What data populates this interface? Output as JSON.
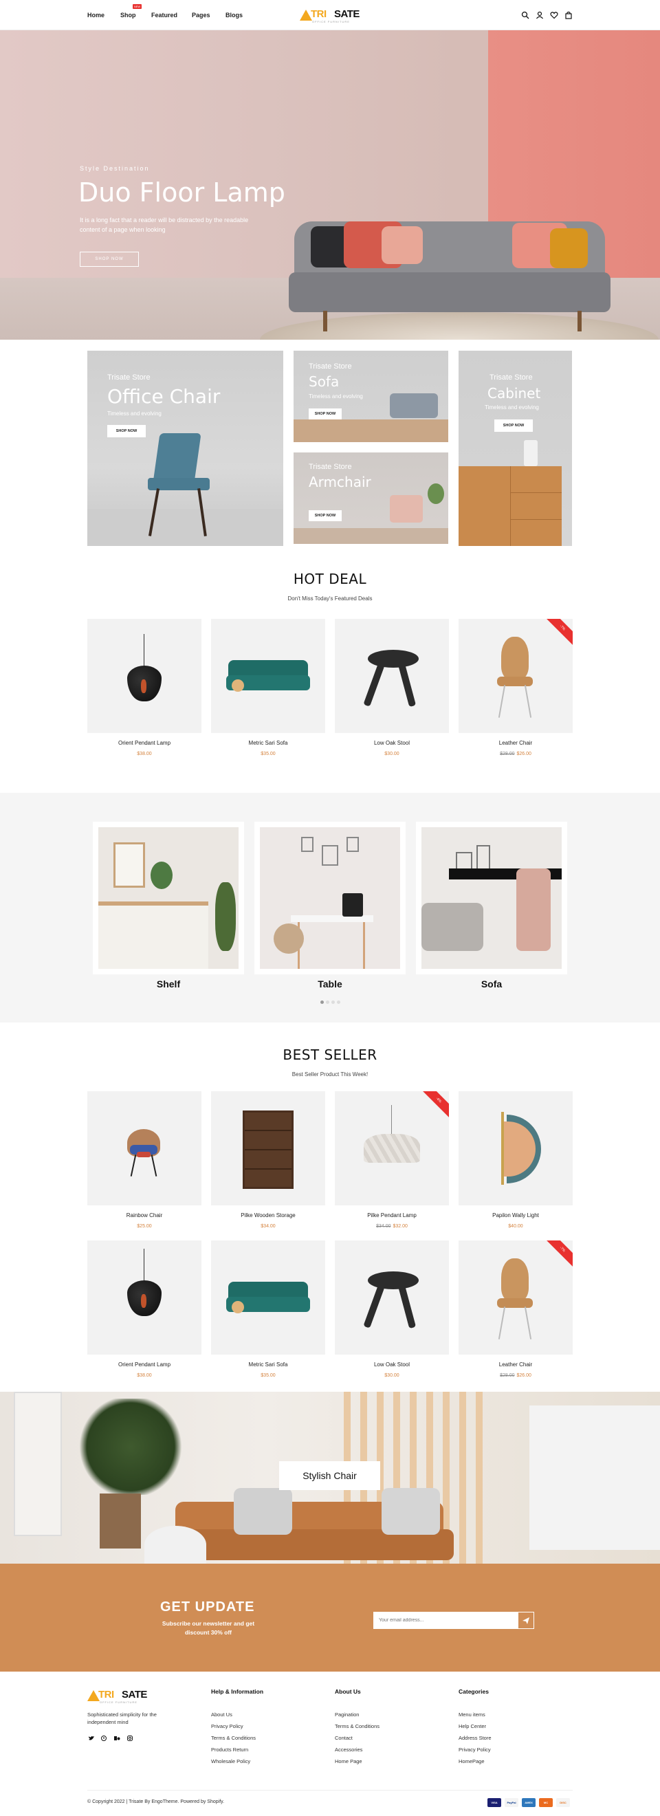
{
  "header": {
    "nav": [
      "Home",
      "Shop",
      "Featured",
      "Pages",
      "Blogs"
    ],
    "new_badge": "NEW",
    "logo_tri": "TRI",
    "logo_sate": "SATE",
    "logo_tagline": "OFFICE FURNITURE"
  },
  "hero": {
    "kicker": "Style Destination",
    "title": "Duo Floor Lamp",
    "description": "It is a long fact that a reader will be distracted by the readable content of a page when looking",
    "button": "SHOP NOW"
  },
  "banners": [
    {
      "store": "Trisate Store",
      "title": "Office Chair",
      "desc": "Timeless and evolving",
      "button": "SHOP NOW"
    },
    {
      "store": "Trisate Store",
      "title": "Sofa",
      "desc": "Timeless and evolving",
      "button": "SHOP NOW"
    },
    {
      "store": "Trisate Store",
      "title": "Armchair",
      "desc": "Timeless and evolving",
      "button": "SHOP NOW"
    },
    {
      "store": "Trisate Store",
      "title": "Cabinet",
      "desc": "Timeless and evolving",
      "button": "SHOP NOW"
    }
  ],
  "hot_deal": {
    "title": "HOT DEAL",
    "subtitle": "Don't Miss Today's Featured Deals",
    "products": [
      {
        "name": "Orient Pendant Lamp",
        "price": "$38.00",
        "old": ""
      },
      {
        "name": "Metric Sari Sofa",
        "price": "$35.00",
        "old": ""
      },
      {
        "name": "Low Oak Stool",
        "price": "$30.00",
        "old": ""
      },
      {
        "name": "Leather Chair",
        "price": "$26.00",
        "old": "$28.00",
        "sale": "-7%"
      }
    ]
  },
  "categories": {
    "items": [
      "Shelf",
      "Table",
      "Sofa"
    ]
  },
  "best_seller": {
    "title": "BEST SELLER",
    "subtitle": "Best Seller Product This Week!",
    "products": [
      {
        "name": "Rainbow Chair",
        "price": "$25.00",
        "old": ""
      },
      {
        "name": "Pilke Wooden Storage",
        "price": "$34.00",
        "old": ""
      },
      {
        "name": "Pilke Pendant Lamp",
        "price": "$32.00",
        "old": "$34.00",
        "sale": "-6%"
      },
      {
        "name": "Papilon Wally Light",
        "price": "$40.00",
        "old": ""
      },
      {
        "name": "Orient Pendant Lamp",
        "price": "$38.00",
        "old": ""
      },
      {
        "name": "Metric Sari Sofa",
        "price": "$35.00",
        "old": ""
      },
      {
        "name": "Low Oak Stool",
        "price": "$30.00",
        "old": ""
      },
      {
        "name": "Leather Chair",
        "price": "$26.00",
        "old": "$28.00",
        "sale": "-7%"
      }
    ]
  },
  "stylish": {
    "label": "Stylish Chair"
  },
  "newsletter": {
    "title": "GET UPDATE",
    "subtitle": "Subscribe our newsletter and get discount 30% off",
    "placeholder": "Your email address..."
  },
  "footer": {
    "about": "Sophisticated simplicity for the independent mind",
    "cols": [
      {
        "title": "Help & Information",
        "links": [
          "About Us",
          "Privacy Policy",
          "Terms & Conditions",
          "Products Return",
          "Wholesale Policy"
        ]
      },
      {
        "title": "About Us",
        "links": [
          "Pagination",
          "Terms & Conditions",
          "Contact",
          "Accessories",
          "Home Page"
        ]
      },
      {
        "title": "Categories",
        "links": [
          "Menu items",
          "Help Center",
          "Address Store",
          "Privacy Policy",
          "HomePage"
        ]
      }
    ],
    "copyright": "© Copyright 2022 | Trisate By EngoTheme. Powered by Shopify.",
    "payments": [
      "VISA",
      "PayPal",
      "AMEX",
      "MC",
      "DISC"
    ]
  },
  "colors": {
    "accent": "#d08d55",
    "price": "#d4823d",
    "sale": "#e8312f",
    "logo": "#f3a81f"
  }
}
